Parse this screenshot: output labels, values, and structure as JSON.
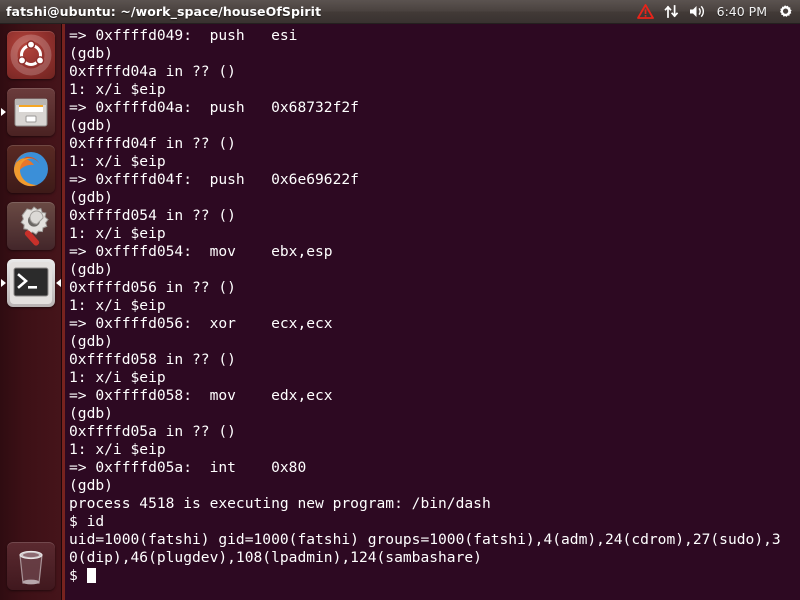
{
  "panel": {
    "title": "fatshi@ubuntu: ~/work_space/houseOfSpirit",
    "clock": "6:40 PM",
    "tray_icons": [
      "warning-triangle-icon",
      "network-icon",
      "volume-icon",
      "system-menu-icon"
    ]
  },
  "launcher": {
    "items": [
      {
        "name": "ubuntu-dash",
        "label": "Ubuntu Dash",
        "active": false,
        "running": false
      },
      {
        "name": "files",
        "label": "Files",
        "active": false,
        "running": true
      },
      {
        "name": "firefox",
        "label": "Firefox Web Browser",
        "active": false,
        "running": false
      },
      {
        "name": "system-settings",
        "label": "System Settings",
        "active": false,
        "running": false
      },
      {
        "name": "terminal",
        "label": "Terminal",
        "active": true,
        "running": true
      }
    ],
    "trash": {
      "name": "trash",
      "label": "Trash"
    }
  },
  "terminal": {
    "prompt": "$ ",
    "cursor_visible": true,
    "lines": [
      "=> 0xffffd049:\tpush   esi",
      "(gdb)",
      "0xffffd04a in ?? ()",
      "1: x/i $eip",
      "=> 0xffffd04a:\tpush   0x68732f2f",
      "(gdb)",
      "0xffffd04f in ?? ()",
      "1: x/i $eip",
      "=> 0xffffd04f:\tpush   0x6e69622f",
      "(gdb)",
      "0xffffd054 in ?? ()",
      "1: x/i $eip",
      "=> 0xffffd054:\tmov    ebx,esp",
      "(gdb)",
      "0xffffd056 in ?? ()",
      "1: x/i $eip",
      "=> 0xffffd056:\txor    ecx,ecx",
      "(gdb)",
      "0xffffd058 in ?? ()",
      "1: x/i $eip",
      "=> 0xffffd058:\tmov    edx,ecx",
      "(gdb)",
      "0xffffd05a in ?? ()",
      "1: x/i $eip",
      "=> 0xffffd05a:\tint    0x80",
      "(gdb)",
      "process 4518 is executing new program: /bin/dash",
      "$ id",
      "uid=1000(fatshi) gid=1000(fatshi) groups=1000(fatshi),4(adm),24(cdrom),27(sudo),3",
      "0(dip),46(plugdev),108(lpadmin),124(sambashare)"
    ]
  },
  "colors": {
    "terminal_bg": "#2d0922",
    "terminal_fg": "#ffffff",
    "launcher_bg": "#3d1016",
    "panel_bg": "#4a423f",
    "window_border": "#77231f",
    "warning_red": "#e02a1f"
  }
}
